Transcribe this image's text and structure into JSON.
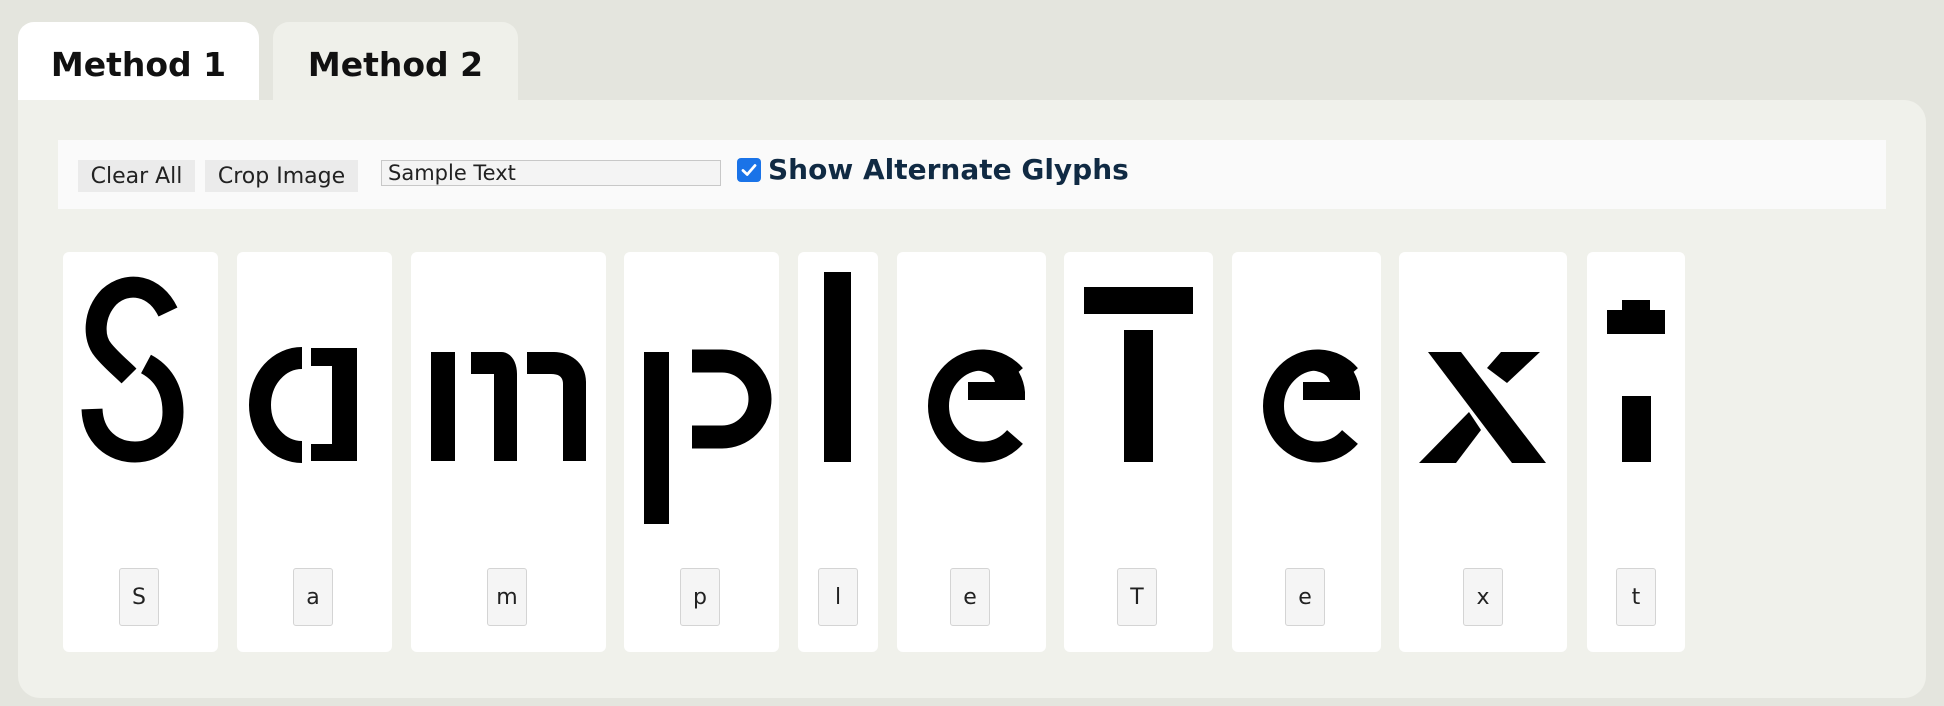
{
  "tabs": [
    {
      "label": "Method 1",
      "active": true
    },
    {
      "label": "Method 2",
      "active": false
    }
  ],
  "toolbar": {
    "clear_label": "Clear All",
    "crop_label": "Crop Image",
    "text_value": "Sample Text",
    "alt_glyphs_label": "Show Alternate Glyphs",
    "alt_glyphs_checked": true
  },
  "glyphs": [
    {
      "char": "S"
    },
    {
      "char": "a"
    },
    {
      "char": "m"
    },
    {
      "char": "p"
    },
    {
      "char": "l"
    },
    {
      "char": "e"
    },
    {
      "char": "T"
    },
    {
      "char": "e"
    },
    {
      "char": "x"
    },
    {
      "char": "t"
    }
  ],
  "colors": {
    "accent": "#1a73e8",
    "glyph": "#000000",
    "label": "#102a43"
  }
}
